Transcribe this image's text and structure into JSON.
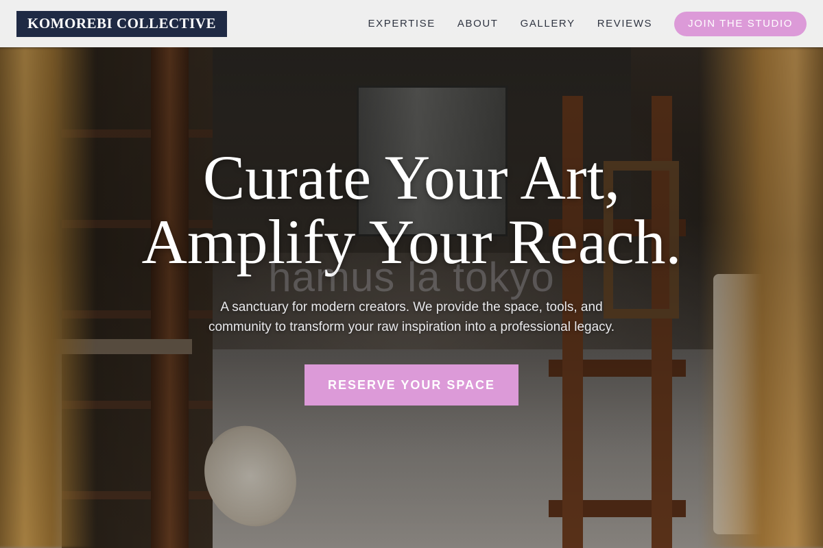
{
  "navbar": {
    "logo": "KOMOREBI COLLECTIVE",
    "links": [
      "EXPERTISE",
      "ABOUT",
      "GALLERY",
      "REVIEWS"
    ],
    "cta_label": "JOIN THE STUDIO"
  },
  "hero": {
    "headline_line1": "Curate Your Art,",
    "headline_line2": "Amplify Your Reach.",
    "watermark": "hamus  la tokyo",
    "subtext_line1": "A sanctuary for modern creators. We provide the space, tools, and",
    "subtext_line2": "community to transform your raw inspiration into a professional legacy.",
    "cta_label": "RESERVE YOUR SPACE",
    "background_image": "art-studio-photo"
  },
  "colors": {
    "accent": "#dc9ad8",
    "logo_bg": "#1f2a44",
    "nav_text": "#2f3441",
    "nav_bg": "#f6f6f6"
  }
}
